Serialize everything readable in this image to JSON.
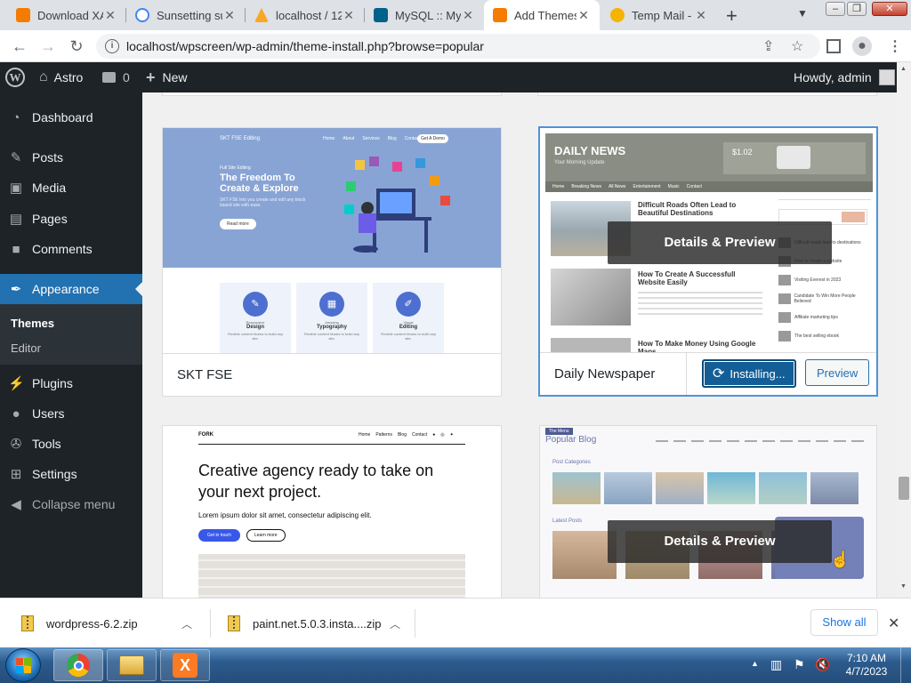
{
  "browser": {
    "tabs": [
      {
        "title": "Download XA",
        "favicon_color": "#f57c00",
        "active": false
      },
      {
        "title": "Sunsetting su",
        "favicon_color": "#4285f4",
        "active": false
      },
      {
        "title": "localhost / 12",
        "favicon_color": "#f9a825",
        "active": false
      },
      {
        "title": "MySQL :: My",
        "favicon_color": "#00618a",
        "active": false
      },
      {
        "title": "Add Themes",
        "favicon_color": "#f57c00",
        "active": true
      },
      {
        "title": "Temp Mail -",
        "favicon_color": "#f4b400",
        "active": false
      }
    ],
    "url": "localhost/wpscreen/wp-admin/theme-install.php?browse=popular"
  },
  "adminbar": {
    "site_name": "Astro",
    "comments_count": "0",
    "new_label": "New",
    "howdy": "Howdy, admin"
  },
  "sidebar": {
    "items": [
      {
        "label": "Dashboard",
        "icon": "dashboard-icon"
      },
      {
        "label": "Posts",
        "icon": "pin-icon"
      },
      {
        "label": "Media",
        "icon": "media-icon"
      },
      {
        "label": "Pages",
        "icon": "pages-icon"
      },
      {
        "label": "Comments",
        "icon": "comment-icon"
      },
      {
        "label": "Appearance",
        "icon": "paintbrush-icon"
      },
      {
        "label": "Plugins",
        "icon": "plug-icon"
      },
      {
        "label": "Users",
        "icon": "user-icon"
      },
      {
        "label": "Tools",
        "icon": "wrench-icon"
      },
      {
        "label": "Settings",
        "icon": "settings-icon"
      },
      {
        "label": "Collapse menu",
        "icon": "collapse-icon"
      }
    ],
    "submenu": [
      "Themes",
      "Editor"
    ]
  },
  "themes": {
    "skt": {
      "name": "SKT FSE",
      "logo_text": "SKT FSE Editing",
      "nav": [
        "Home",
        "About",
        "Services",
        "Blog",
        "Contact"
      ],
      "cta": "Get A Demo",
      "eyebrow": "Full Site Editing",
      "headline": "The Freedom To Create & Explore",
      "body": "SKT FSE lets you create and edit any block based site with ease.",
      "button": "Read more",
      "features": [
        {
          "small": "Responsive",
          "label": "Design"
        },
        {
          "small": "Amazing",
          "label": "Typography"
        },
        {
          "small": "Visual",
          "label": "Editing"
        }
      ],
      "feature_desc": "Flexible content blocks to build any site."
    },
    "daily": {
      "name": "Daily Newspaper",
      "masthead": "DAILY NEWS",
      "tagline": "Your Morning Update",
      "nav": [
        "Home",
        "Breaking News",
        "All News",
        "Entertainment",
        "Music",
        "Contact"
      ],
      "ad_price": "$1.02",
      "posts": [
        "Difficult Roads Often Lead to Beautiful Destinations",
        "How To Create A Successfull Website Easily",
        "How To Make Money Using Google Maps"
      ],
      "side_posts": [
        "Difficult roads lead to destinations",
        "How to create a website",
        "Visiting Everest in 2023",
        "Candidate To Win More People Believed",
        "Affiliate marketing tips",
        "The best selling ebook"
      ],
      "overlay": "Details & Preview",
      "install_label": "Installing...",
      "preview_label": "Preview"
    },
    "fork": {
      "logo": "FORK",
      "nav": [
        "Home",
        "Patterns",
        "Blog",
        "Contact"
      ],
      "headline": "Creative agency ready to take on your next project.",
      "body": "Lorem ipsum dolor sit amet, consectetur adipiscing elit.",
      "btn1": "Get in touch",
      "btn2": "Learn more"
    },
    "popular": {
      "badge": "The Menu",
      "title": "Popular Blog",
      "section1": "Post Categories",
      "section2": "Latest Posts",
      "overlay": "Details & Preview"
    }
  },
  "downloads": {
    "items": [
      "wordpress-6.2.zip",
      "paint.net.5.0.3.insta....zip"
    ],
    "show_all": "Show all"
  },
  "taskbar": {
    "time": "7:10 AM",
    "date": "4/7/2023"
  },
  "colors": {
    "wp_admin_dark": "#1d2327",
    "wp_blue": "#2271b1",
    "install_blue": "#135e96",
    "content_bg": "#f0f0f1",
    "skt_hero": "#88a4d4"
  }
}
